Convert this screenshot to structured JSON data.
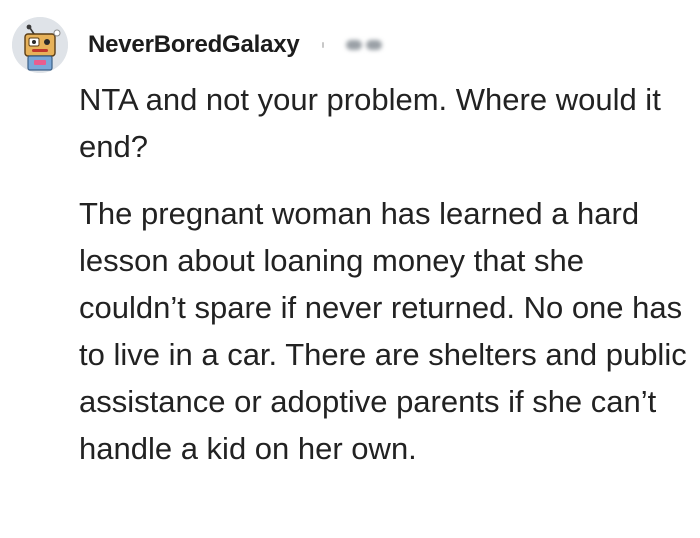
{
  "comment": {
    "author": "NeverBoredGalaxy",
    "avatar_icon": "robot-avatar-icon",
    "paragraphs": [
      "NTA and not your problem. Where would it end?",
      "The pregnant woman has learned a hard lesson about loaning money that she couldn’t spare if never returned. No one has to live in a car. There are shelters and public assistance or adoptive parents if she can’t handle a kid on her own."
    ]
  },
  "colors": {
    "text": "#222222",
    "username": "#1c1c1c",
    "background": "#ffffff"
  }
}
